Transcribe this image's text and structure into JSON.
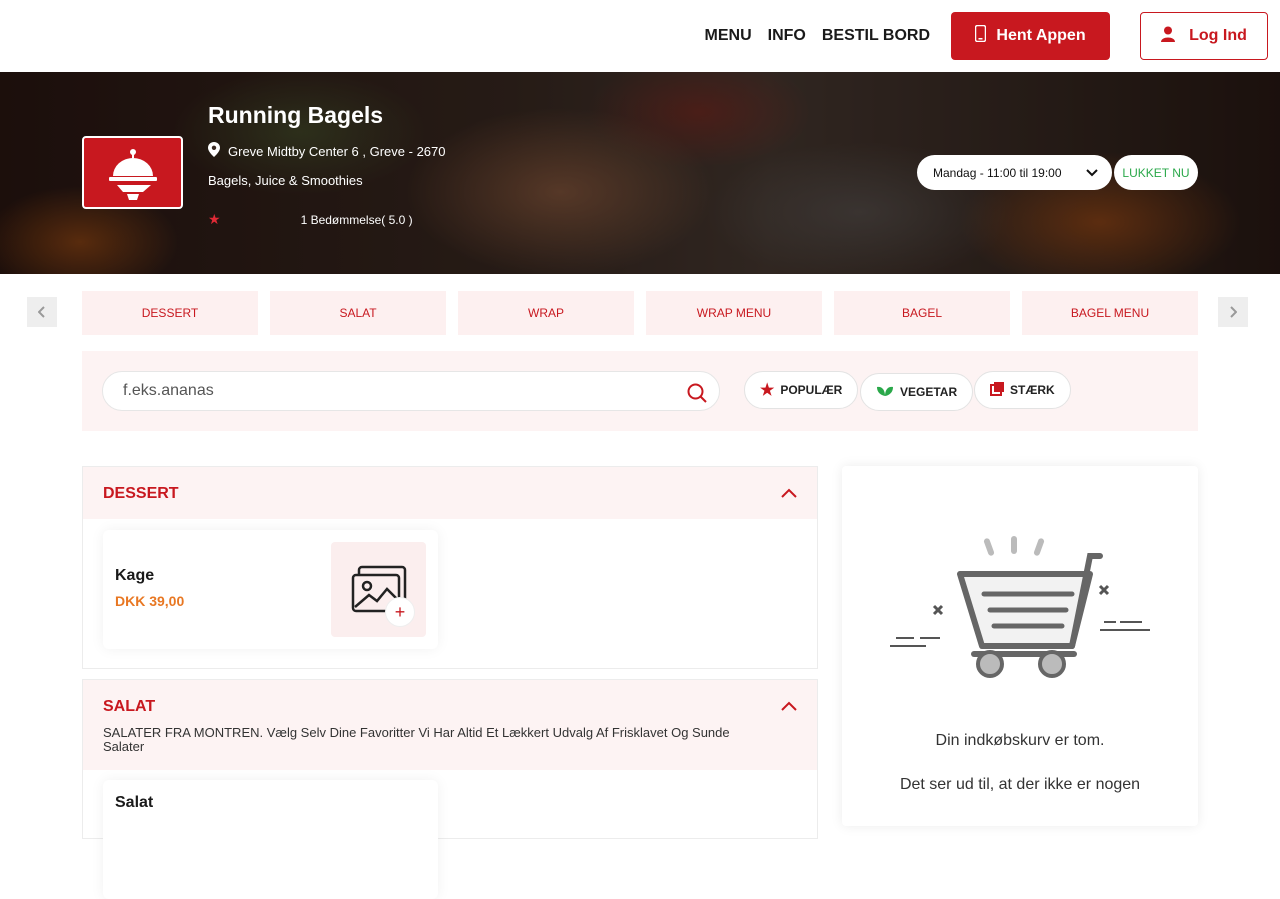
{
  "nav": {
    "links": [
      "MENU",
      "INFO",
      "BESTIL BORD"
    ],
    "app_button": "Hent Appen",
    "login_button": "Log Ind"
  },
  "restaurant": {
    "name": "Running Bagels",
    "address": "Greve Midtby Center 6 , Greve - 2670",
    "categories": "Bagels, Juice & Smoothies",
    "rating_text": "1  Bedømmelse( 5.0 )",
    "hours": "Mandag - 11:00 til 19:00",
    "status": "LUKKET NU",
    "status_color": "#2aa84a"
  },
  "tabs": [
    "DESSERT",
    "SALAT",
    "WRAP",
    "WRAP MENU",
    "BAGEL",
    "BAGEL MENU"
  ],
  "search": {
    "placeholder": "f.eks.ananas",
    "filters": [
      "POPULÆR",
      "VEGETAR",
      "STÆRK"
    ]
  },
  "sections": [
    {
      "title": "DESSERT",
      "description": "",
      "items": [
        {
          "name": "Kage",
          "price": "DKK 39,00"
        }
      ]
    },
    {
      "title": "SALAT",
      "description": "SALATER FRA MONTREN. Vælg Selv Dine Favoritter Vi Har Altid Et Lækkert Udvalg Af Frisklavet Og Sunde Salater",
      "items": [
        {
          "name": "Salat",
          "price": ""
        }
      ]
    }
  ],
  "cart": {
    "empty_title": "Din indkøbskurv er tom.",
    "empty_sub": "Det ser ud til, at der ikke er nogen"
  },
  "colors": {
    "accent": "#c8181f",
    "price": "#e87722",
    "panel_bg": "#fdf3f3"
  }
}
